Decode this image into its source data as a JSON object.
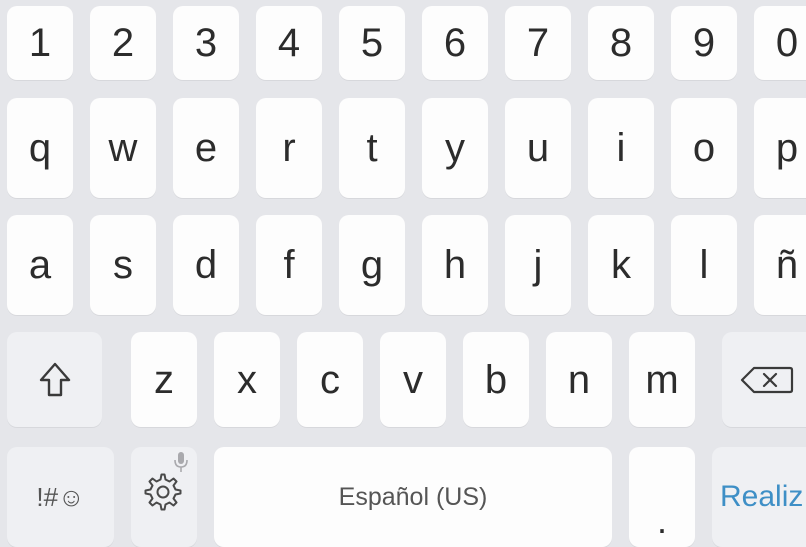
{
  "keyboard": {
    "number_row": [
      "1",
      "2",
      "3",
      "4",
      "5",
      "6",
      "7",
      "8",
      "9",
      "0"
    ],
    "row_q": [
      "q",
      "w",
      "e",
      "r",
      "t",
      "y",
      "u",
      "i",
      "o",
      "p"
    ],
    "row_a": [
      "a",
      "s",
      "d",
      "f",
      "g",
      "h",
      "j",
      "k",
      "l",
      "ñ"
    ],
    "row_z": [
      "z",
      "x",
      "c",
      "v",
      "b",
      "n",
      "m"
    ],
    "symbols_label": "!#☺",
    "space_label": "Español (US)",
    "period_label": ".",
    "action_label": "Realiz",
    "icons": {
      "shift": "shift-arrow-icon",
      "backspace": "backspace-icon",
      "settings": "gear-icon",
      "voice": "microphone-icon",
      "emoji": "smiley-icon"
    },
    "colors": {
      "background": "#e5e6ea",
      "key": "#fdfdfd",
      "function_key": "#eff0f3",
      "key_text": "#2c2c2c",
      "action_text": "#3e8fc6"
    }
  }
}
